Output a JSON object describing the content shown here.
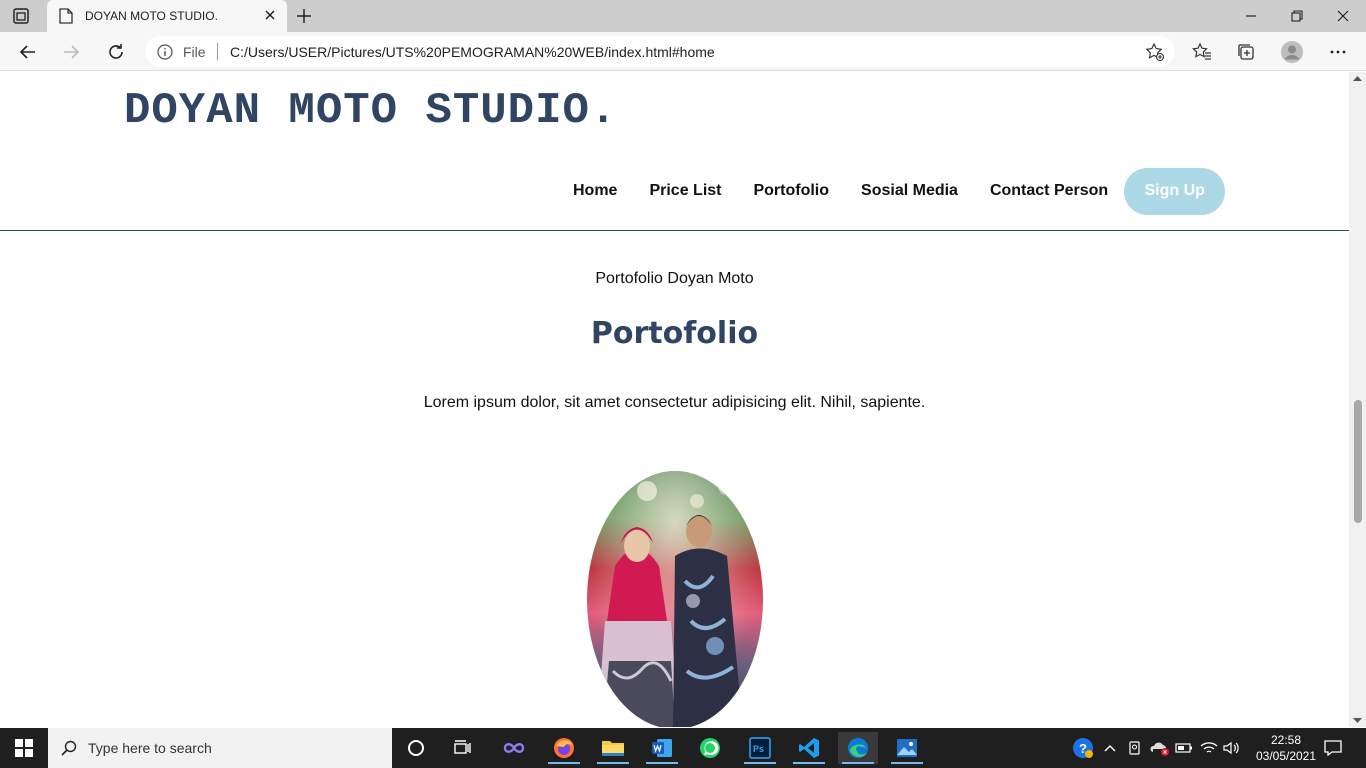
{
  "browser": {
    "tab_title": "DOYAN MOTO STUDIO.",
    "address_prefix": "File",
    "url": "C:/Users/USER/Pictures/UTS%20PEMOGRAMAN%20WEB/index.html#home"
  },
  "site": {
    "brand": "DOYAN MOTO STUDIO.",
    "nav": [
      "Home",
      "Price List",
      "Portofolio",
      "Sosial Media",
      "Contact Person"
    ],
    "signup_label": "Sign Up",
    "signup_color": "#add8e6",
    "brand_color": "#2f4563"
  },
  "section": {
    "subtitle": "Portofolio Doyan Moto",
    "heading": "Portofolio",
    "text": "Lorem ipsum dolor, sit amet consectetur adipisicing elit. Nihil, sapiente."
  },
  "taskbar": {
    "search_placeholder": "Type here to search",
    "time": "22:58",
    "date": "03/05/2021"
  }
}
